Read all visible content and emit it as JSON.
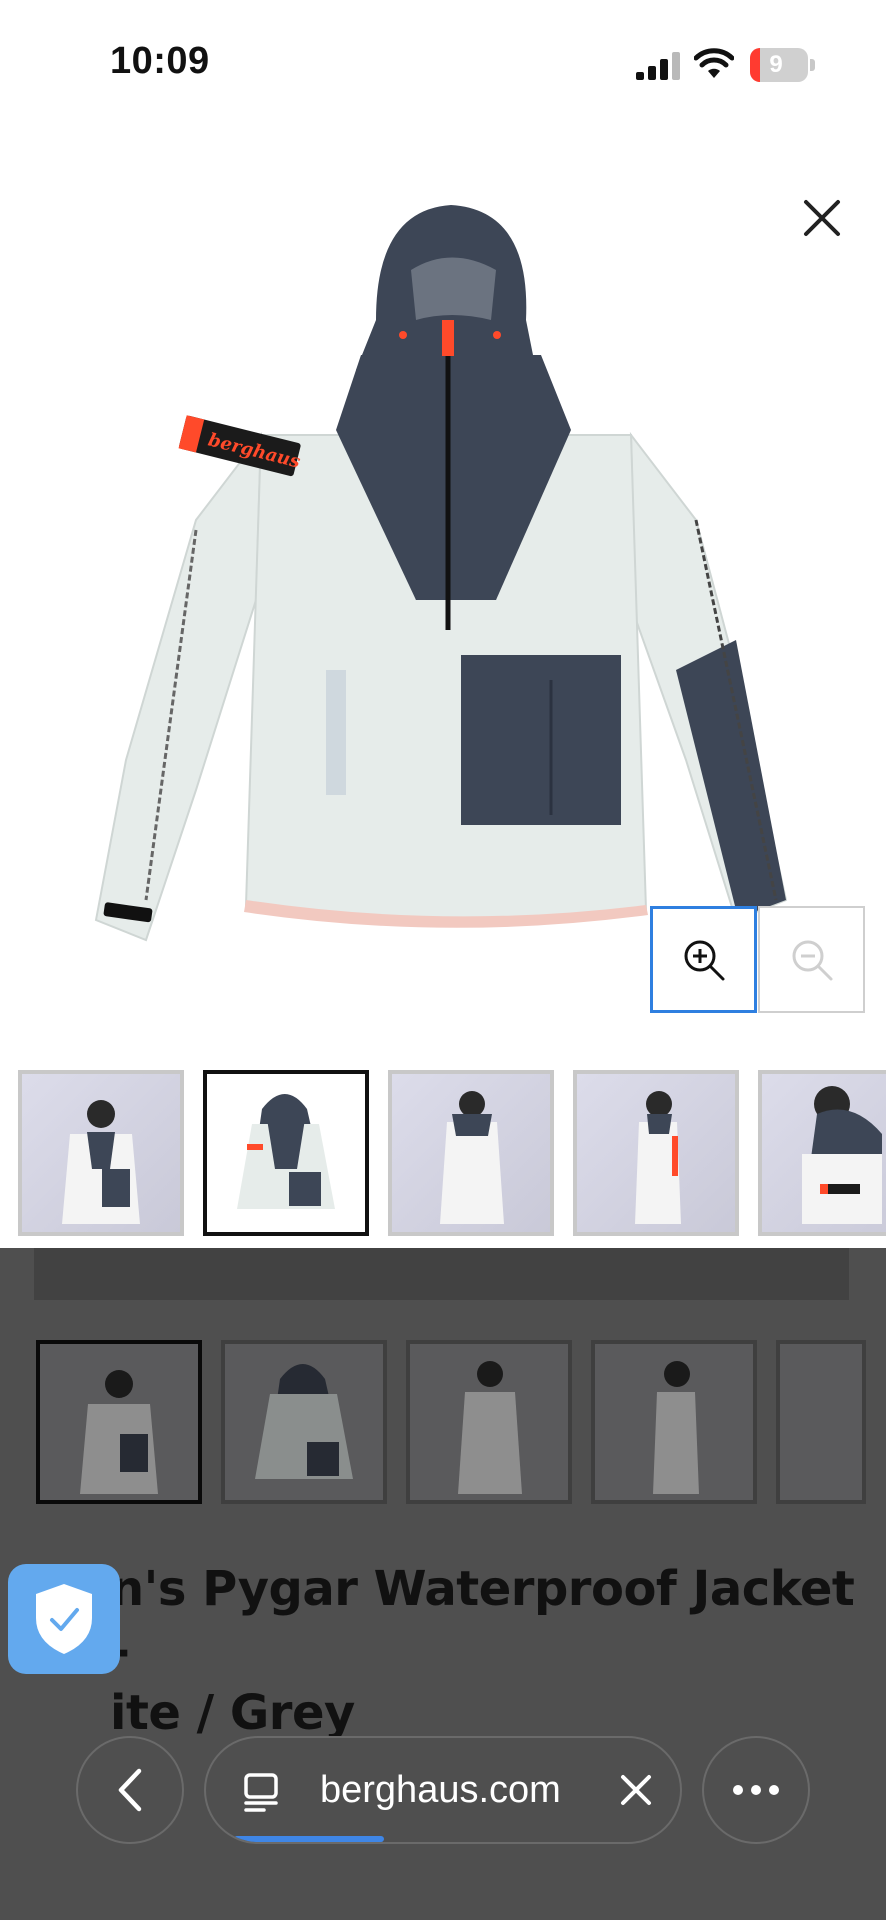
{
  "status_bar": {
    "time": "10:09",
    "battery_level": "9",
    "icons": [
      "signal-icon",
      "wifi-icon",
      "battery-icon"
    ]
  },
  "viewer": {
    "close_icon": "close-icon",
    "zoom_in_icon": "zoom-in-icon",
    "zoom_out_icon": "zoom-out-icon",
    "zoom_out_enabled": false,
    "image_logo_text": "berghaus"
  },
  "thumbnails": {
    "count_visible": 5,
    "selected_index": 1
  },
  "background_page": {
    "thumbnail_selected_index": 0,
    "product_title_line1": "n's Pygar Waterproof Jacket -",
    "product_title_line2": "ite / Grey"
  },
  "browser": {
    "url": "berghaus.com",
    "back_icon": "chevron-left-icon",
    "tabs_icon": "page-menu-icon",
    "clear_icon": "close-icon",
    "more_icon": "more-icon",
    "shield_icon": "shield-check-icon"
  },
  "colors": {
    "accent_blue": "#2e7fe0",
    "jacket_white": "#e6ecea",
    "jacket_navy": "#3d4656",
    "logo_orange": "#ff4a2a",
    "overlay": "#4f4f4f",
    "shield": "#63a9ee"
  }
}
